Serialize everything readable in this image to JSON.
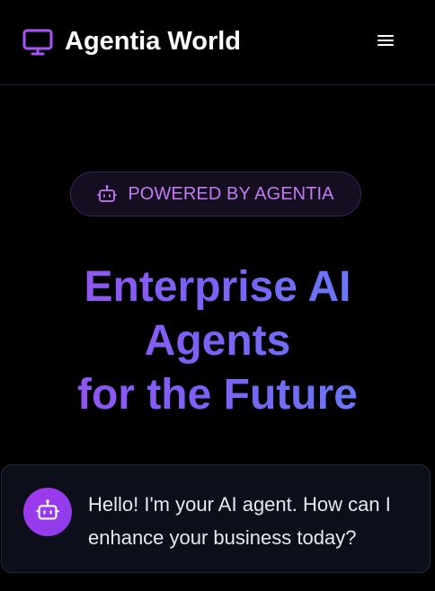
{
  "header": {
    "brand": "Agentia World",
    "logo_icon": "monitor-icon",
    "menu_icon": "hamburger-menu-icon"
  },
  "badge": {
    "icon": "robot-icon",
    "label": "POWERED BY AGENTIA"
  },
  "hero": {
    "title_lines": [
      "Enterprise AI",
      "Agents",
      "for the Future"
    ]
  },
  "chat": {
    "avatar_icon": "robot-icon",
    "message": "Hello! I'm your AI agent. How can I enhance your business today?"
  },
  "colors": {
    "background": "#000000",
    "accent_purple": "#9b4ff0",
    "accent_blue": "#5f82f8",
    "badge_text": "#c27cf2",
    "card_background": "#0c0f19"
  }
}
